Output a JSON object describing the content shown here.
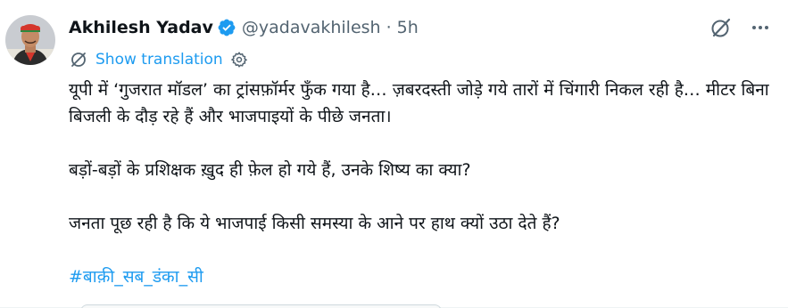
{
  "author": {
    "display_name": "Akhilesh Yadav",
    "handle": "@yadavakhilesh",
    "separator": "·",
    "time": "5h"
  },
  "icons": {
    "verified": "verified-badge-icon",
    "grok": "grok-icon",
    "more": "more-icon",
    "translate": "translate-icon",
    "settings": "settings-icon"
  },
  "colors": {
    "accent": "#1d9bf0",
    "text": "#0f1419",
    "muted": "#536471"
  },
  "translation": {
    "label": "Show translation"
  },
  "tweet": {
    "paragraph1": "यूपी में ‘गुजरात मॉडल’ का ट्रांसफ़ॉर्मर फुँक गया है… ज़बरदस्ती जोड़े गये तारों में चिंगारी निकल रही है… मीटर बिना बिजली के दौड़ रहे हैं और भाजपाइयों के पीछे जनता।",
    "paragraph2": "बड़ों-बड़ों के प्रशिक्षक ख़ुद ही फ़ेल हो गये हैं, उनके शिष्य का क्या?",
    "paragraph3": "जनता पूछ रही है कि ये भाजपाई किसी समस्या के आने पर हाथ क्यों उठा देते हैं?",
    "hashtag": "#बाक़ी_सब_डंका_सी"
  }
}
